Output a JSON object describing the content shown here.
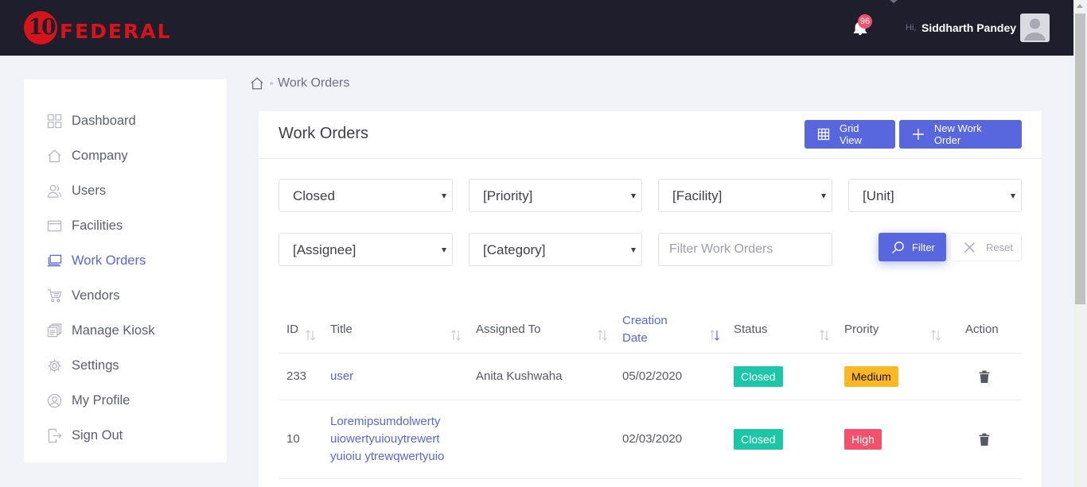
{
  "header": {
    "logo_number": "10",
    "logo_text": "FEDERAL",
    "notification_count": "96",
    "greeting": "Hi,",
    "user_name": "Siddharth Pandey"
  },
  "sidebar": {
    "items": [
      {
        "label": "Dashboard",
        "icon": "dashboard-icon",
        "active": false
      },
      {
        "label": "Company",
        "icon": "home-icon",
        "active": false
      },
      {
        "label": "Users",
        "icon": "users-icon",
        "active": false
      },
      {
        "label": "Facilities",
        "icon": "facilities-icon",
        "active": false
      },
      {
        "label": "Work Orders",
        "icon": "work-orders-icon",
        "active": true
      },
      {
        "label": "Vendors",
        "icon": "vendors-icon",
        "active": false
      },
      {
        "label": "Manage Kiosk",
        "icon": "kiosk-icon",
        "active": false
      },
      {
        "label": "Settings",
        "icon": "settings-icon",
        "active": false
      },
      {
        "label": "My Profile",
        "icon": "profile-icon",
        "active": false
      },
      {
        "label": "Sign Out",
        "icon": "sign-out-icon",
        "active": false
      }
    ]
  },
  "breadcrumb": {
    "current": "Work Orders"
  },
  "card": {
    "title": "Work Orders",
    "grid_view_label": "Grid View",
    "new_work_order_label": "New Work Order"
  },
  "filters": {
    "status": "Closed",
    "priority": "[Priority]",
    "facility": "[Facility]",
    "unit": "[Unit]",
    "assignee": "[Assignee]",
    "category": "[Category]",
    "search_placeholder": "Filter Work Orders",
    "filter_label": "Filter",
    "reset_label": "Reset"
  },
  "table": {
    "columns": [
      {
        "label": "ID",
        "line1": "ID",
        "line2": ""
      },
      {
        "label": "Title",
        "line1": "Title",
        "line2": ""
      },
      {
        "label": "Assigned To",
        "line1": "Assigned To",
        "line2": ""
      },
      {
        "label": "Creation Date",
        "line1": "Creation",
        "line2": "Date"
      },
      {
        "label": "Status",
        "line1": "Status",
        "line2": ""
      },
      {
        "label": "Prority",
        "line1": "Prority",
        "line2": ""
      },
      {
        "label": "Action",
        "line1": "Action",
        "line2": ""
      }
    ],
    "sorted_column": "Creation Date",
    "rows": [
      {
        "id": "233",
        "title_lines": [
          "user"
        ],
        "assigned_to": "Anita Kushwaha",
        "creation_date": "05/02/2020",
        "status": "Closed",
        "priority": "Medium"
      },
      {
        "id": "10",
        "title_lines": [
          "Loremipsumdolwerty",
          "uiowertyuiouytrewert",
          "yuioiu ytrewqwertyuio"
        ],
        "assigned_to": "",
        "creation_date": "02/03/2020",
        "status": "Closed",
        "priority": "High"
      }
    ]
  },
  "colors": {
    "topbar": "#1e1e2d",
    "brand_red": "#d7141a",
    "accent": "#5867dd",
    "status_closed": "#1cc6a7",
    "priority_medium": "#ffb822",
    "priority_high": "#f4516c"
  }
}
